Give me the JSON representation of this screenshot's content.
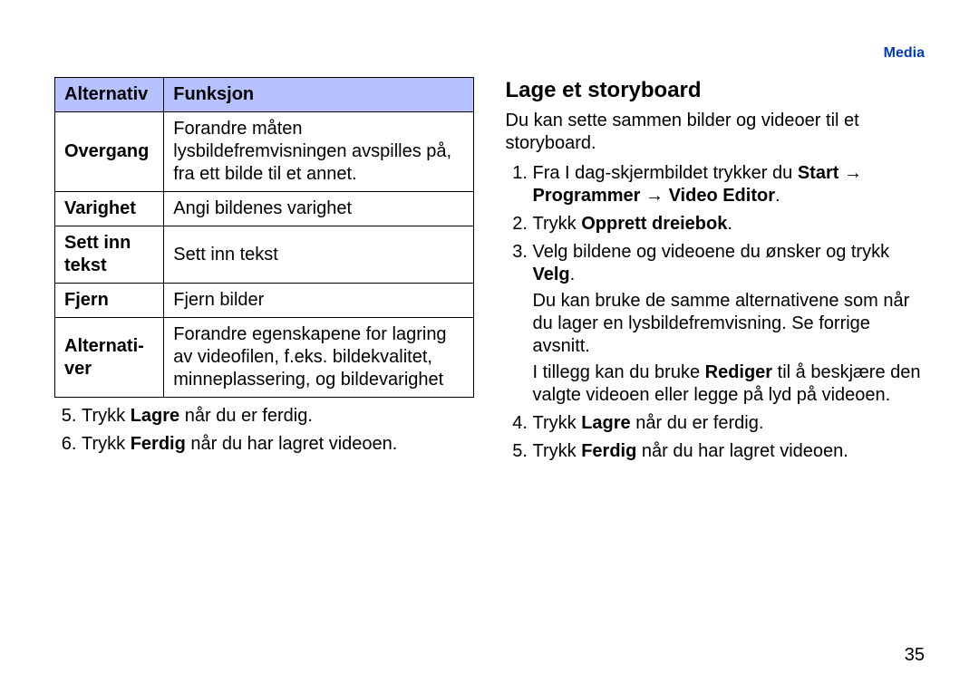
{
  "header": {
    "section": "Media"
  },
  "page_number": "35",
  "left": {
    "table": {
      "headers": [
        "Alternativ",
        "Funksjon"
      ],
      "rows": [
        {
          "opt": "Overgang",
          "func": "Forandre måten lysbildefremvisningen avspilles på, fra ett bilde til et annet."
        },
        {
          "opt": "Varighet",
          "func": "Angi bildenes varighet"
        },
        {
          "opt": "Sett inn tekst",
          "func": "Sett inn tekst"
        },
        {
          "opt": "Fjern",
          "func": "Fjern bilder"
        },
        {
          "opt": "Alternati-ver",
          "func": "Forandre egenskapene for lagring av videofilen, f.eks. bildekvalitet, minneplassering, og bildevarighet"
        }
      ]
    },
    "list": {
      "step5_a": "Trykk ",
      "step5_b": "Lagre",
      "step5_c": " når du er ferdig.",
      "step6_a": "Trykk ",
      "step6_b": "Ferdig",
      "step6_c": " når du har lagret videoen."
    }
  },
  "right": {
    "heading": "Lage et storyboard",
    "intro": "Du kan sette sammen bilder og videoer til et storyboard.",
    "step1_a": "Fra I dag-skjermbildet trykker du ",
    "step1_b": "Start",
    "step1_c": " → ",
    "step1_d": "Programmer",
    "step1_e": " → ",
    "step1_f": "Video Editor",
    "step1_g": ".",
    "step2_a": "Trykk ",
    "step2_b": "Opprett dreiebok",
    "step2_c": ".",
    "step3_a": "Velg bildene og videoene du ønsker og trykk ",
    "step3_b": "Velg",
    "step3_c": ".",
    "step3_para1": "Du kan bruke de samme alternativene som når du lager en lysbildefremvisning. Se forrige avsnitt.",
    "step3_para2_a": "I tillegg kan du bruke ",
    "step3_para2_b": "Rediger",
    "step3_para2_c": " til å beskjære den valgte videoen eller legge på lyd på videoen.",
    "step4_a": "Trykk ",
    "step4_b": "Lagre",
    "step4_c": " når du er ferdig.",
    "step5_a": "Trykk ",
    "step5_b": "Ferdig",
    "step5_c": " når du har lagret videoen."
  }
}
